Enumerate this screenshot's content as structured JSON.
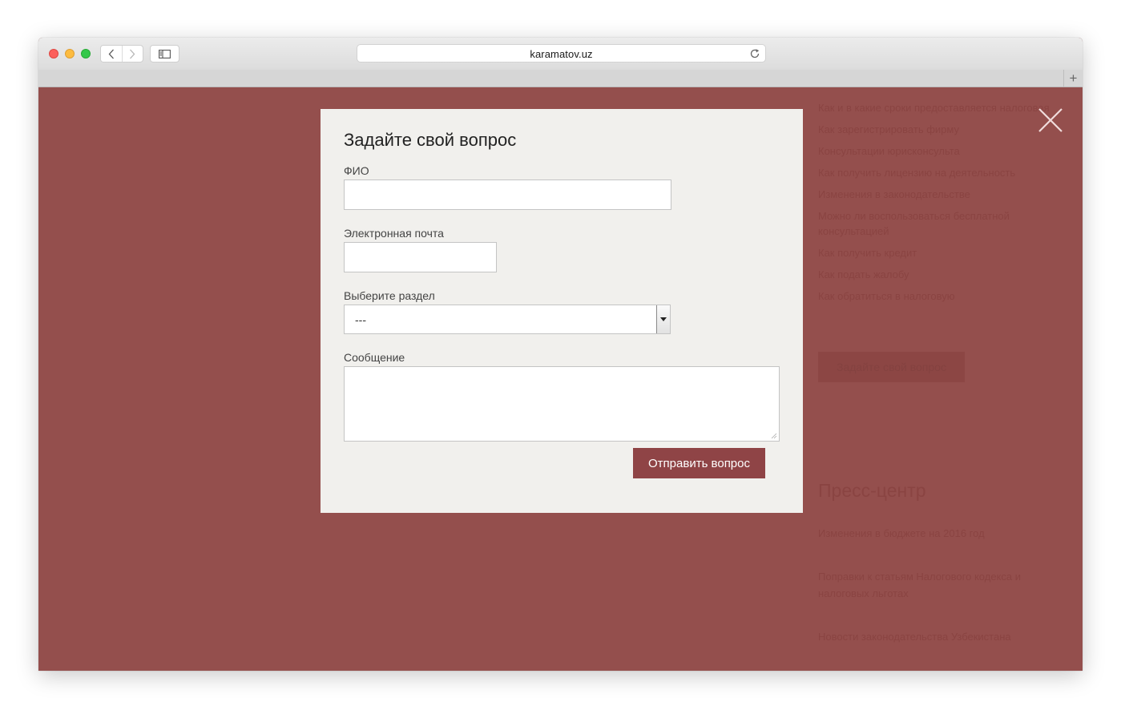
{
  "browser": {
    "url": "karamatov.uz",
    "new_tab_symbol": "+"
  },
  "colors": {
    "overlay": "#944f4d",
    "modal_bg": "#f1f0ed",
    "accent_button": "#8f4446"
  },
  "icons": {
    "back": "chevron-left-icon",
    "forward": "chevron-right-icon",
    "sidebar": "sidebar-icon",
    "reload": "reload-icon",
    "close": "close-icon"
  },
  "modal": {
    "title": "Задайте свой вопрос",
    "fields": {
      "name": {
        "label": "ФИО",
        "value": ""
      },
      "email": {
        "label": "Электронная почта",
        "value": ""
      },
      "section": {
        "label": "Выберите раздел",
        "selected": "---"
      },
      "message": {
        "label": "Сообщение",
        "value": ""
      }
    },
    "submit_label": "Отправить вопрос"
  },
  "background_page": {
    "faq_links": [
      "Как и в какие сроки предоставляется налоговая",
      "Как зарегистрировать фирму",
      "Консультации юрисконсульта",
      "Как получить лицензию на деятельность",
      "Изменения в законодательстве",
      "Можно ли воспользоваться бесплатной консультацией",
      "Как получить кредит",
      "Как подать жалобу",
      "Как обратиться в налоговую"
    ],
    "ask_button": "Задайте свой вопрос",
    "press_heading": "Пресс-центр",
    "press_items": [
      "Изменения в бюджете на 2016 год",
      "Поправки к статьям Налогового кодекса и налоговых льготах",
      "Новости законодательства Узбекистана"
    ]
  }
}
